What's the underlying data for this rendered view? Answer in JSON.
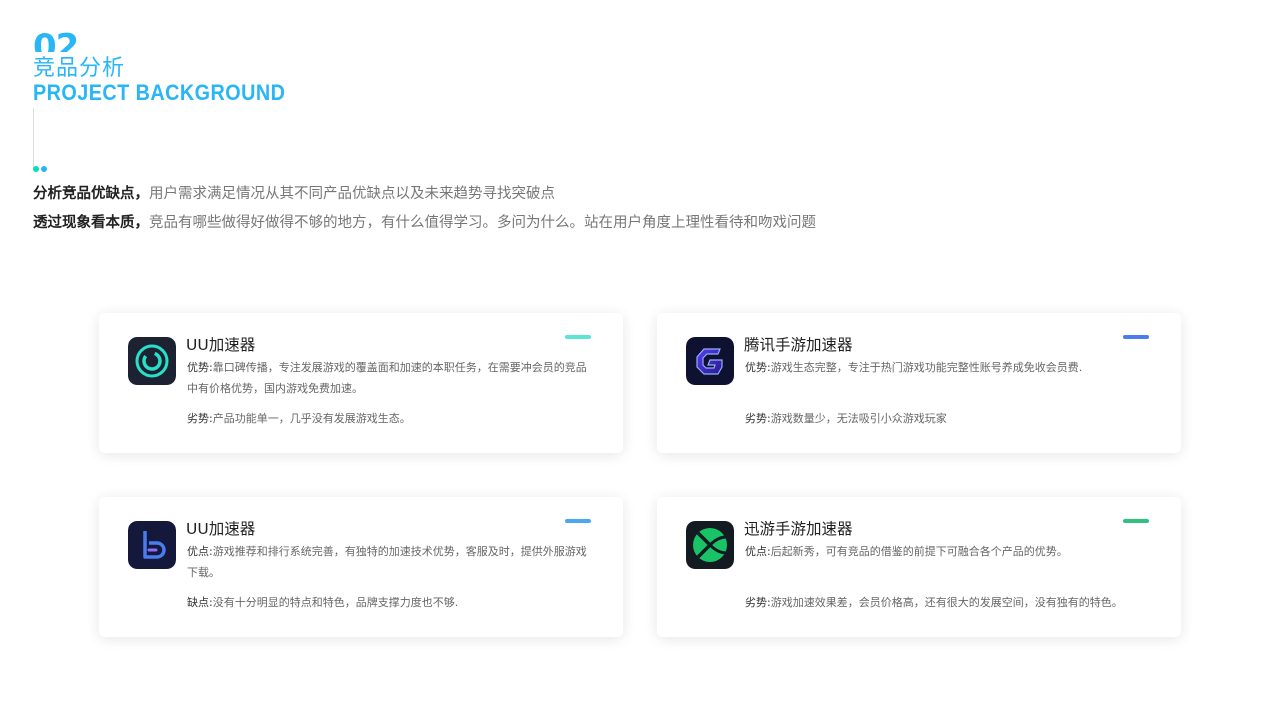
{
  "header": {
    "section_number": "02",
    "title_cn": "竞品分析",
    "title_en": "PROJECT BACKGROUND",
    "accent_color": "#29b6f6",
    "dot_colors": [
      "#00e0b8",
      "#29b6f6"
    ]
  },
  "intro": [
    {
      "lead": "分析竞品优缺点，",
      "rest": "用户需求满足情况从其不同产品优缺点以及未来趋势寻找突破点"
    },
    {
      "lead": "透过现象看本质，",
      "rest": "竞品有哪些做得好做得不够的地方，有什么值得学习。多问为什么。站在用户角度上理性看待和吻戏问题"
    }
  ],
  "cards": [
    {
      "name": "UU加速器",
      "logo_icon": "uu-power-ring-icon",
      "accent_color": "#5ce5d4",
      "pro_label": "优势:",
      "pro_text": "靠口碑传播，专注发展游戏的覆盖面和加速的本职任务，在需要冲会员的竞品中有价格优势，国内游戏免费加速。",
      "con_label": "劣势:",
      "con_text": "产品功能单一，几乎没有发展游戏生态。"
    },
    {
      "name": "腾讯手游加速器",
      "logo_icon": "tencent-g-icon",
      "accent_color": "#4a7cf0",
      "pro_label": "优势:",
      "pro_text": "游戏生态完整，专注于热门游戏功能完整性账号养成免收会员费.",
      "con_label": "劣势:",
      "con_text": "游戏数量少，无法吸引小众游戏玩家"
    },
    {
      "name": "UU加速器",
      "logo_icon": "b-letter-icon",
      "accent_color": "#4aa8f0",
      "pro_label": "优点:",
      "pro_text": "游戏推荐和排行系统完善，有独特的加速技术优势，客服及时，提供外服游戏下载。",
      "con_label": "缺点:",
      "con_text": "没有十分明显的特点和特色，品牌支撑力度也不够."
    },
    {
      "name": "迅游手游加速器",
      "logo_icon": "xunyou-globe-icon",
      "accent_color": "#2ec27e",
      "pro_label": "优点:",
      "pro_text": "后起新秀，可有竞品的借鉴的前提下可融合各个产品的优势。",
      "con_label": "劣势:",
      "con_text": "游戏加速效果差，会员价格高，还有很大的发展空间，没有独有的特色。"
    }
  ]
}
